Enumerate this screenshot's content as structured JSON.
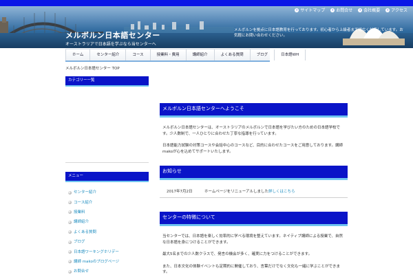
{
  "header": {
    "top_links": [
      "サイトマップ",
      "お問合せ",
      "会社概要",
      "アクセス"
    ],
    "site_title": "メルボルン日本語センター",
    "site_sub": "オーストラリアで日本語を学ぶなら当センターへ",
    "description": "メルボルンを拠点に日本語教育を行っております。初心者から上級者まで幅広く対応しています。お気軽にお問い合わせください。"
  },
  "nav": {
    "items": [
      "ホーム",
      "センター紹介",
      "コース",
      "授業料・費用",
      "講師紹介",
      "よくある質問",
      "ブログ",
      "日本語WH"
    ]
  },
  "breadcrumb": "メルボルン日本語センター TOP",
  "sidebar": {
    "section1_title": "カテゴリー一覧",
    "section2_title": "メニュー",
    "menu_items": [
      "センター紹介",
      "コース紹介",
      "授業料",
      "講師紹介",
      "よくある質問",
      "ブログ",
      "日本語ワーキングホリデー",
      "講師 makoのブログページ",
      "お問合せ"
    ]
  },
  "main": {
    "welcome_title": "メルボルン日本語センターへようこそ",
    "welcome_p1": "メルボルン日本語センターは、オーストラリアのメルボルンで日本語を学びたい方のための日本語学校です。少人数制で、一人ひとりに合わせた丁寧な指導を行っています。",
    "welcome_p2": "日本語能力試験の対策コースや会話中心のコースなど、目的に合わせたコースをご用意しております。講師 makoが心を込めてサポートいたします。",
    "news_title": "お知らせ",
    "news_date": "2017年7月2日",
    "news_text": "ホームページをリニューアルしました",
    "news_link": "詳しくはこちら",
    "about_title": "センターの特徴について",
    "about_p1": "当センターでは、日本語を楽しく効率的に学べる環境を整えています。ネイティブ講師による授業で、自然な日本語を身につけることができます。",
    "about_p2": "最大5名までの少人数クラスで、発言の機会が多く、確実に力をつけることができます。",
    "about_p3": "また、日本文化の体験イベントも定期的に開催しており、言葉だけでなく文化も一緒に学ぶことができます。"
  }
}
